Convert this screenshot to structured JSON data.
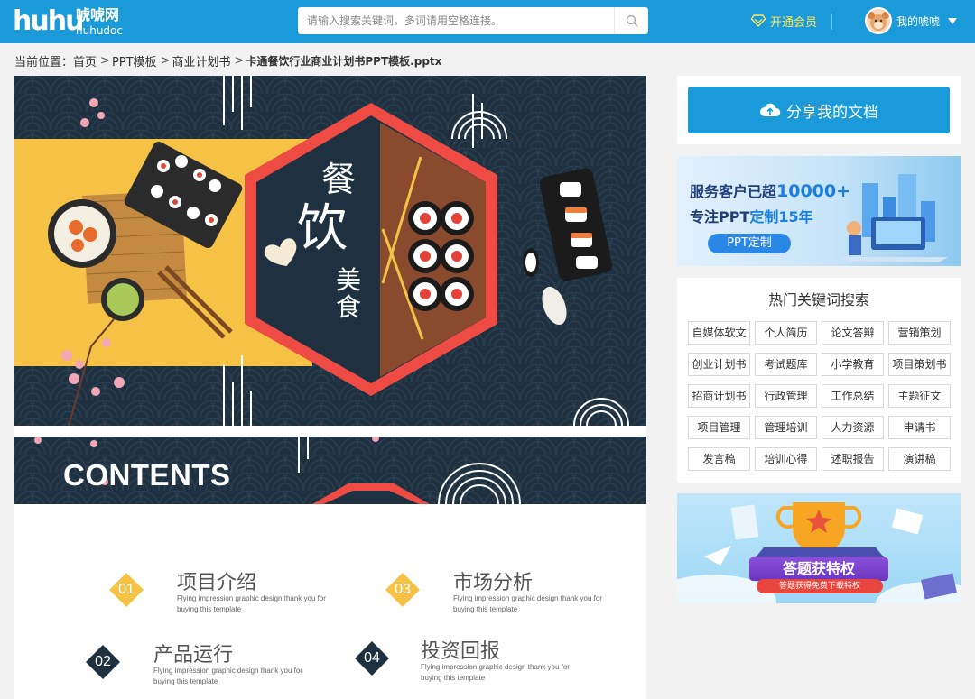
{
  "header": {
    "logo_mark": "huhu",
    "logo_cn": "唬唬网",
    "logo_en": "huhudoc",
    "search_placeholder": "请输入搜索关键词，多词请用空格连接。",
    "vip_label": "开通会员",
    "user_label": "我的唬唬",
    "colors": {
      "bar": "#1a9ad8",
      "vip": "#ffe65b"
    }
  },
  "breadcrumb": {
    "prefix": "当前位置：",
    "items": [
      "首页",
      "PPT模板",
      "商业计划书"
    ],
    "current": "卡通餐饮行业商业计划书PPT模板.pptx"
  },
  "slide1": {
    "title_chars": [
      "餐",
      "饮"
    ],
    "subtitle_chars": [
      "美",
      "食"
    ]
  },
  "slide2": {
    "title": "CONTENTS",
    "items": [
      {
        "num": "01",
        "title": "项目介绍",
        "desc": "Flying impression graphic design thank you for buying this template"
      },
      {
        "num": "03",
        "title": "市场分析",
        "desc": "Flying impression graphic design thank you for buying this template"
      },
      {
        "num": "02",
        "title": "产品运行",
        "desc": "Flying impression graphic design thank you for buying this template"
      },
      {
        "num": "04",
        "title": "投资回报",
        "desc": "Flying impression graphic design thank you for buying this template"
      }
    ]
  },
  "sidebar": {
    "share_label": "分享我的文档",
    "banner1": {
      "line1_pre": "服务客户已超",
      "line1_hl": "10000+",
      "line2_pre": "专注PPT",
      "line2_hl": "定制15年",
      "button": "PPT定制"
    },
    "keywords_title": "热门关键词搜索",
    "keywords": [
      "自媒体软文",
      "个人简历",
      "论文答辩",
      "营销策划",
      "创业计划书",
      "考试题库",
      "小学教育",
      "项目策划书",
      "招商计划书",
      "行政管理",
      "工作总结",
      "主题征文",
      "项目管理",
      "管理培训",
      "人力资源",
      "申请书",
      "发言稿",
      "培训心得",
      "述职报告",
      "演讲稿"
    ],
    "banner2": {
      "title": "答题获特权",
      "subtitle": "答题获得免费下载特权"
    }
  }
}
